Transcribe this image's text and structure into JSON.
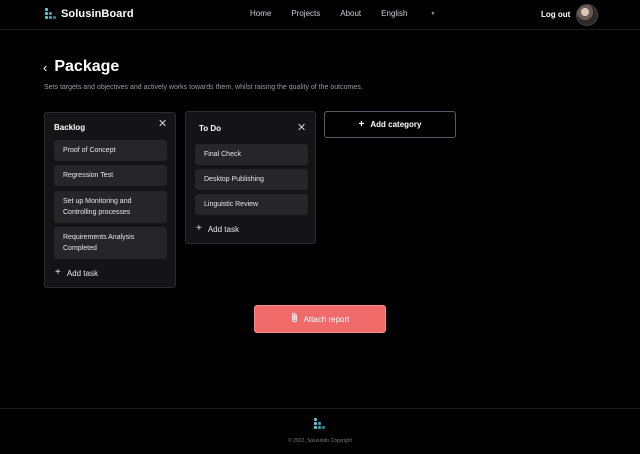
{
  "brand": {
    "name": "SolusinBoard",
    "accent": "#5fc7d6"
  },
  "nav": {
    "items": [
      "Home",
      "Projects",
      "About"
    ],
    "language": "English"
  },
  "header": {
    "logout": "Log out"
  },
  "page": {
    "title": "Package",
    "subtitle": "Sets targets and objectives and actively works towards them, whilst raising the quality of the outcomes."
  },
  "columns": [
    {
      "title": "Backlog",
      "tasks": [
        "Proof of Concept",
        "Regression Test",
        "Set up Monitoring and Controlling processes",
        "Requirements Analysis Completed"
      ],
      "add_label": "Add task"
    },
    {
      "title": "To Do",
      "tasks": [
        "Final Check",
        "Desktop Publishing",
        "Linguistic Review"
      ],
      "add_label": "Add task"
    }
  ],
  "add_category": "Add category",
  "attach_report": "Attach report",
  "footer": {
    "copyright": "© 2022, Solusindo Copyright"
  },
  "colors": {
    "background": "#000000",
    "card": "#141416",
    "task": "#26262a",
    "attach": "#f06a6a"
  },
  "icons": {
    "back": "chevron-left-icon",
    "close": "close-icon",
    "plus": "plus-icon",
    "attach": "paperclip-icon"
  }
}
